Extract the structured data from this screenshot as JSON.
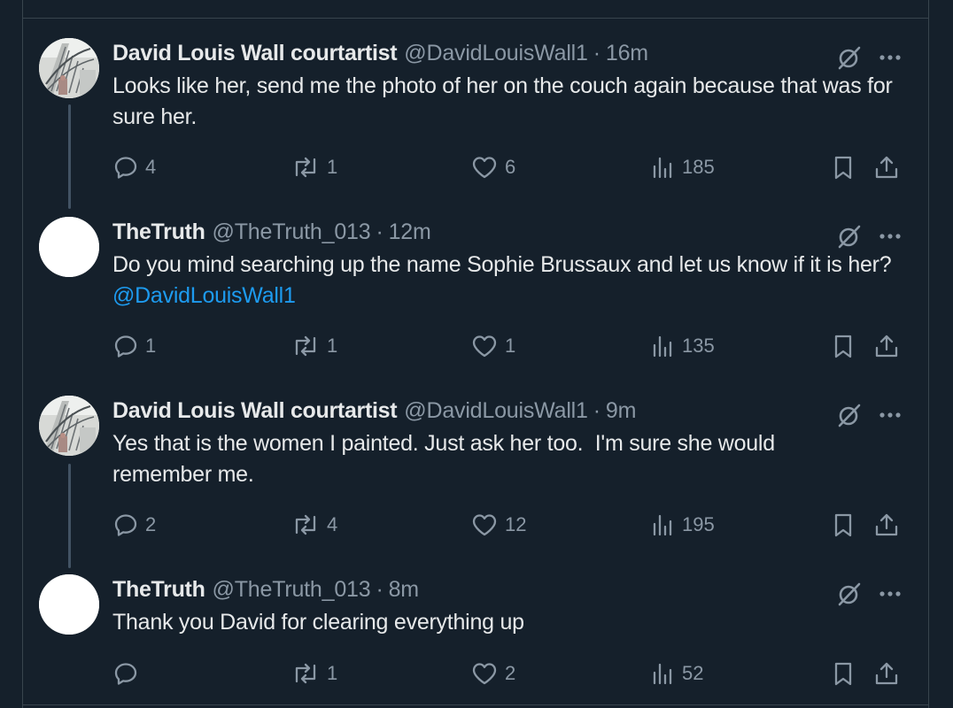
{
  "colors": {
    "background": "#15202b",
    "text": "#e7e9ea",
    "muted": "#8b98a5",
    "mention": "#1d9bf0",
    "divider": "#38444d"
  },
  "tweets": [
    {
      "display_name": "David Louis Wall courtartist",
      "handle": "@DavidLouisWall1",
      "separator": "·",
      "time": "16m",
      "text": "Looks like her, send me the photo of her on the couch again because that was for sure her.",
      "mention": "",
      "avatar": "staircase-photo",
      "replies": "4",
      "reposts": "1",
      "likes": "6",
      "views": "185"
    },
    {
      "display_name": "TheTruth",
      "handle": "@TheTruth_013",
      "separator": "·",
      "time": "12m",
      "text": "Do you mind searching up the name Sophie Brussaux and let us know if it is her? ",
      "mention": "@DavidLouisWall1",
      "avatar": "blank-white",
      "replies": "1",
      "reposts": "1",
      "likes": "1",
      "views": "135"
    },
    {
      "display_name": "David Louis Wall courtartist",
      "handle": "@DavidLouisWall1",
      "separator": "·",
      "time": "9m",
      "text": "Yes that is the women I painted. Just ask her too.  I'm sure she would remember me.",
      "mention": "",
      "avatar": "staircase-photo",
      "replies": "2",
      "reposts": "4",
      "likes": "12",
      "views": "195"
    },
    {
      "display_name": "TheTruth",
      "handle": "@TheTruth_013",
      "separator": "·",
      "time": "8m",
      "text": "Thank you David for clearing everything up",
      "mention": "",
      "avatar": "blank-white",
      "replies": "",
      "reposts": "1",
      "likes": "2",
      "views": "52"
    }
  ],
  "icons": {
    "reply": "reply-icon",
    "repost": "repost-icon",
    "like": "heart-icon",
    "views": "views-icon",
    "bookmark": "bookmark-icon",
    "share": "share-icon",
    "grok": "grok-icon",
    "more": "more-icon"
  }
}
